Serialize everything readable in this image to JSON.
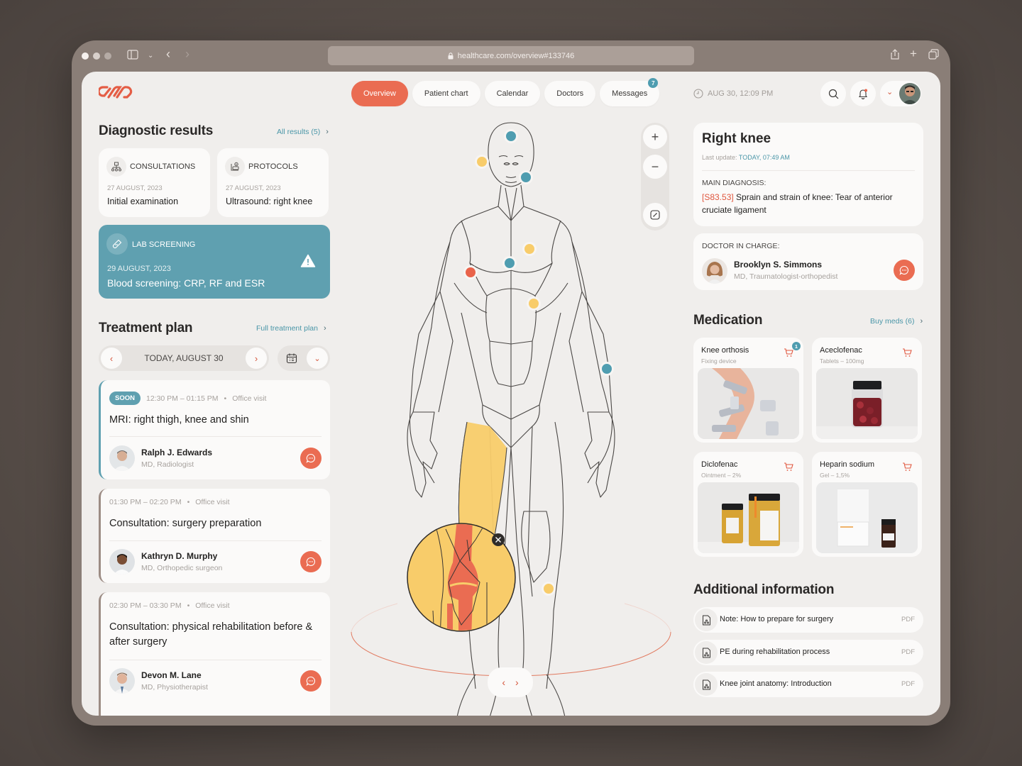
{
  "browser": {
    "url": "healthcare.com/overview#133746"
  },
  "header": {
    "nav": [
      {
        "label": "Overview",
        "active": true
      },
      {
        "label": "Patient chart"
      },
      {
        "label": "Calendar"
      },
      {
        "label": "Doctors"
      },
      {
        "label": "Messages",
        "badge": "7"
      }
    ],
    "datetime": "AUG 30, 12:09 PM"
  },
  "diagnostic": {
    "title": "Diagnostic results",
    "link": "All results (5)",
    "cards": [
      {
        "type": "CONSULTATIONS",
        "date": "27 AUGUST, 2023",
        "title": "Initial examination",
        "icon": "org-chart-icon"
      },
      {
        "type": "PROTOCOLS",
        "date": "27 AUGUST, 2023",
        "title": "Ultrasound: right knee",
        "icon": "ultrasound-icon"
      }
    ],
    "lab": {
      "type": "LAB SCREENING",
      "date": "29 AUGUST, 2023",
      "title": "Blood screening: CRP, RF and ESR",
      "icon": "test-tube-icon",
      "alert": "warning-icon"
    }
  },
  "treatment": {
    "title": "Treatment plan",
    "link": "Full treatment plan",
    "date_label": "TODAY, AUGUST 30",
    "appointments": [
      {
        "badge": "SOON",
        "time": "12:30 PM – 01:15 PM",
        "kind": "Office visit",
        "title": "MRI: right thigh, knee and shin",
        "doctor": "Ralph J. Edwards",
        "role": "MD, Radiologist"
      },
      {
        "time": "01:30 PM – 02:20 PM",
        "kind": "Office visit",
        "title": "Consultation: surgery preparation",
        "doctor": "Kathryn D. Murphy",
        "role": "MD, Orthopedic surgeon"
      },
      {
        "time": "02:30 PM – 03:30 PM",
        "kind": "Office visit",
        "title": "Consultation: physical rehabilitation before & after surgery",
        "doctor": "Devon M. Lane",
        "role": "MD, Physiotherapist"
      }
    ]
  },
  "body_map": {
    "markers": [
      {
        "area": "head-top",
        "status": "teal"
      },
      {
        "area": "ear",
        "status": "yellow"
      },
      {
        "area": "jaw",
        "status": "teal"
      },
      {
        "area": "chest",
        "status": "yellow"
      },
      {
        "area": "sternum",
        "status": "teal"
      },
      {
        "area": "ribs",
        "status": "red"
      },
      {
        "area": "abdomen",
        "status": "yellow"
      },
      {
        "area": "left-wrist",
        "status": "teal"
      },
      {
        "area": "left-ankle",
        "status": "yellow"
      }
    ],
    "highlighted": "Right thigh / knee",
    "colors": {
      "teal": "#4f9db0",
      "yellow": "#f8cc6a",
      "red": "#e9634a",
      "accent": "#ea6c52"
    }
  },
  "right_knee": {
    "title": "Right knee",
    "update_label": "Last update:",
    "update_value": "TODAY, 07:49 AM",
    "diagnosis_label": "MAIN DIAGNOSIS:",
    "diagnosis_code": "[S83.53]",
    "diagnosis_text": " Sprain and strain of knee: Tear of anterior cruciate ligament"
  },
  "doctor_in_charge": {
    "label": "DOCTOR IN CHARGE:",
    "name": "Brooklyn S. Simmons",
    "role": "MD, Traumatologist-orthopedist"
  },
  "medication": {
    "title": "Medication",
    "link": "Buy meds (6)",
    "items": [
      {
        "name": "Knee orthosis",
        "sub": "Fixing device",
        "cart_count": "1"
      },
      {
        "name": "Aceclofenac",
        "sub": "Tablets – 100mg"
      },
      {
        "name": "Diclofenac",
        "sub": "Ointment – 2%"
      },
      {
        "name": "Heparin sodium",
        "sub": "Gel – 1,5%"
      }
    ]
  },
  "additional": {
    "title": "Additional information",
    "docs": [
      {
        "label": "Note: How to prepare for surgery",
        "type": "PDF"
      },
      {
        "label": "PE during rehabilitation process",
        "type": "PDF"
      },
      {
        "label": "Knee joint anatomy: Introduction",
        "type": "PDF"
      }
    ]
  }
}
